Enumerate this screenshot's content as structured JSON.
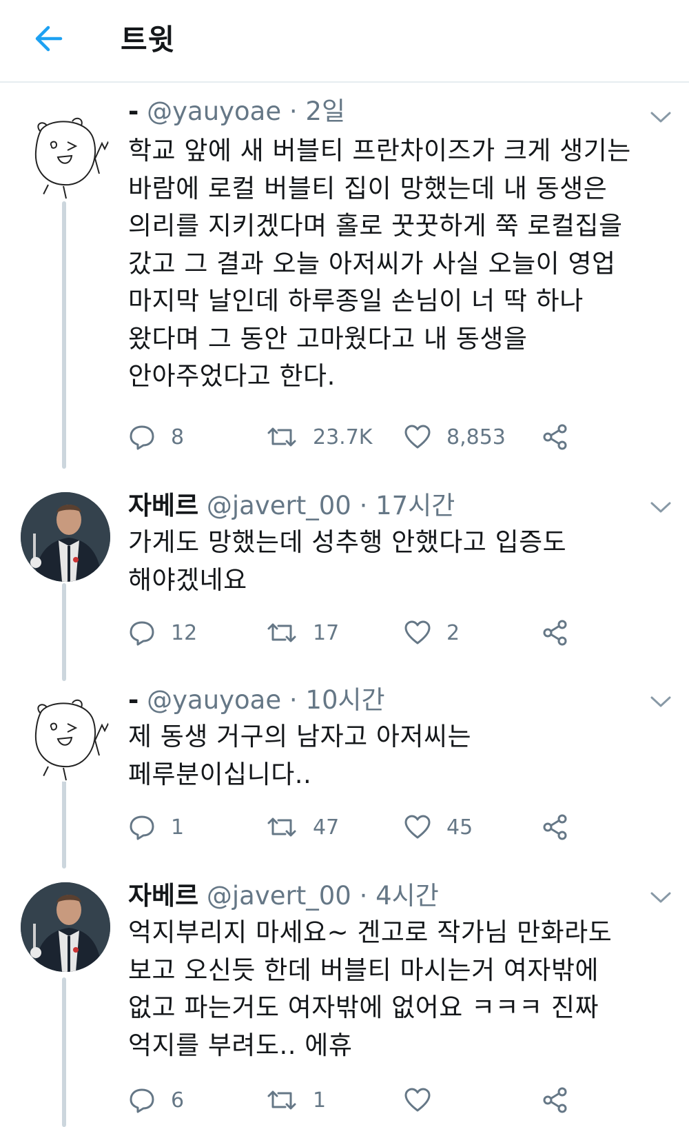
{
  "header": {
    "title": "트윗",
    "back_icon": "arrow-left-icon",
    "accent": "#1da1f2"
  },
  "tweets": [
    {
      "name": "-",
      "handle": "@yauyoae",
      "dot": "·",
      "time": "2일",
      "avatar": "doodle-avatar",
      "lines": [
        "학교 앞에 새 버블티 프란차이즈가 크게 생기는",
        "바람에 로컬 버블티 집이 망했는데 내 동생은",
        "의리를 지키겠다며 홀로 꿋꿋하게 쭉 로컬집을",
        "갔고 그 결과 오늘 아저씨가 사실 오늘이 영업",
        "마지막 날인데 하루종일 손님이 너 딱 하나",
        "왔다며 그 동안 고마웠다고 내 동생을",
        "안아주었다고 한다."
      ],
      "replies": "8",
      "retweets": "23.7K",
      "likes": "8,853"
    },
    {
      "name": "자베르",
      "handle": "@javert_00",
      "dot": "·",
      "time": "17시간",
      "avatar": "photo-avatar",
      "lines": [
        "가게도 망했는데 성추행 안했다고 입증도",
        "해야겠네요"
      ],
      "replies": "12",
      "retweets": "17",
      "likes": "2"
    },
    {
      "name": "-",
      "handle": "@yauyoae",
      "dot": "·",
      "time": "10시간",
      "avatar": "doodle-avatar",
      "lines": [
        "제 동생 거구의 남자고 아저씨는",
        "페루분이십니다.."
      ],
      "replies": "1",
      "retweets": "47",
      "likes": "45"
    },
    {
      "name": "자베르",
      "handle": "@javert_00",
      "dot": "·",
      "time": "4시간",
      "avatar": "photo-avatar",
      "lines": [
        "억지부리지 마세요~ 겐고로 작가님 만화라도",
        "보고 오신듯 한데 버블티 마시는거 여자밖에",
        "없고 파는거도 여자밖에 없어요 ㅋㅋㅋ 진짜",
        "억지를 부려도.. 에휴"
      ],
      "replies": "6",
      "retweets": "1",
      "likes": ""
    }
  ],
  "colors": {
    "text": "#14171a",
    "muted": "#657786",
    "thread": "#ccd6dd",
    "divider": "#e6ecf0"
  }
}
